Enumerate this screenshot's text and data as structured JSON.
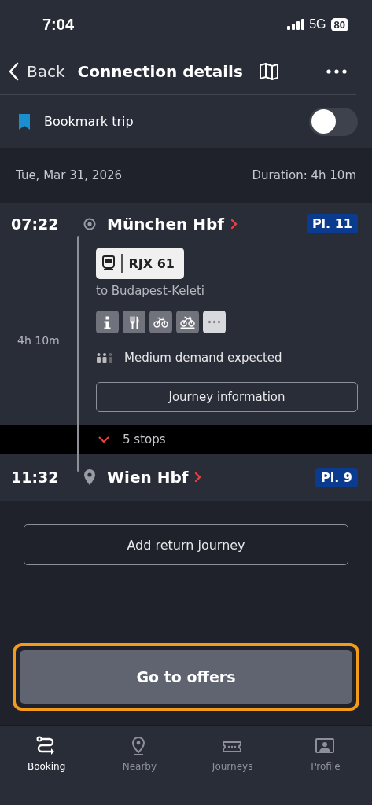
{
  "status_bar": {
    "time": "7:04",
    "network": "5G",
    "battery": "80"
  },
  "nav": {
    "back": "Back",
    "title": "Connection details"
  },
  "bookmark": {
    "label": "Bookmark trip",
    "on": false
  },
  "date": "Tue, Mar 31, 2026",
  "duration": "Duration: 4h 10m",
  "departure": {
    "time": "07:22",
    "station": "München Hbf",
    "platform": "Pl. 11"
  },
  "train": {
    "name": "RJX 61",
    "destination": "to Budapest-Keleti",
    "travel_time": "4h 10m"
  },
  "amenities": [
    {
      "kind": "info"
    },
    {
      "kind": "restaurant"
    },
    {
      "kind": "bike"
    },
    {
      "kind": "bike-reservation"
    },
    {
      "kind": "more"
    }
  ],
  "demand": "Medium demand expected",
  "journey_info_button": "Journey information",
  "stops": {
    "label": "5 stops",
    "expanded": false
  },
  "arrival": {
    "time": "11:32",
    "station": "Wien Hbf",
    "platform": "Pl. 9"
  },
  "return_button": "Add return journey",
  "offers_button": "Go to offers",
  "tabs": [
    {
      "label": "Booking",
      "selected": true,
      "kind": "route"
    },
    {
      "label": "Nearby",
      "selected": false,
      "kind": "pin"
    },
    {
      "label": "Journeys",
      "selected": false,
      "kind": "ticket"
    },
    {
      "label": "Profile",
      "selected": false,
      "kind": "profile"
    }
  ]
}
